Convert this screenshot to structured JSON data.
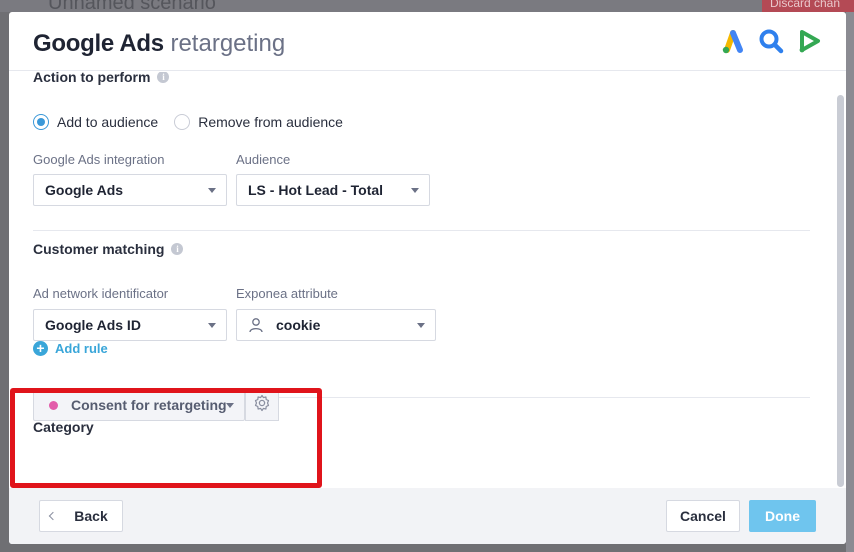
{
  "backdrop": {
    "scenario_title": "Unnamed scenario",
    "discard_label": "Discard chan"
  },
  "modal": {
    "title_main": "Google Ads",
    "title_sub": "retargeting",
    "header_icons": [
      "google-ads-icon",
      "search-ads-icon",
      "video-ads-icon"
    ]
  },
  "action": {
    "section_title": "Action to perform",
    "options": [
      {
        "label": "Add to audience",
        "checked": true
      },
      {
        "label": "Remove from audience",
        "checked": false
      }
    ],
    "integration_label": "Google Ads integration",
    "integration_value": "Google Ads",
    "audience_label": "Audience",
    "audience_value": "LS - Hot Lead - Total"
  },
  "matching": {
    "section_title": "Customer matching",
    "identifier_label": "Ad network identificator",
    "identifier_value": "Google Ads ID",
    "attribute_label": "Exponea attribute",
    "attribute_value": "cookie",
    "add_rule_label": "Add rule"
  },
  "category": {
    "section_title": "Category",
    "value": "Consent for retargeting",
    "dot_color": "#e25caa"
  },
  "footer": {
    "back_label": "Back",
    "cancel_label": "Cancel",
    "done_label": "Done"
  },
  "colors": {
    "accent": "#3a98d8",
    "done_button": "#6fc5ee",
    "highlight": "#e0141b"
  }
}
